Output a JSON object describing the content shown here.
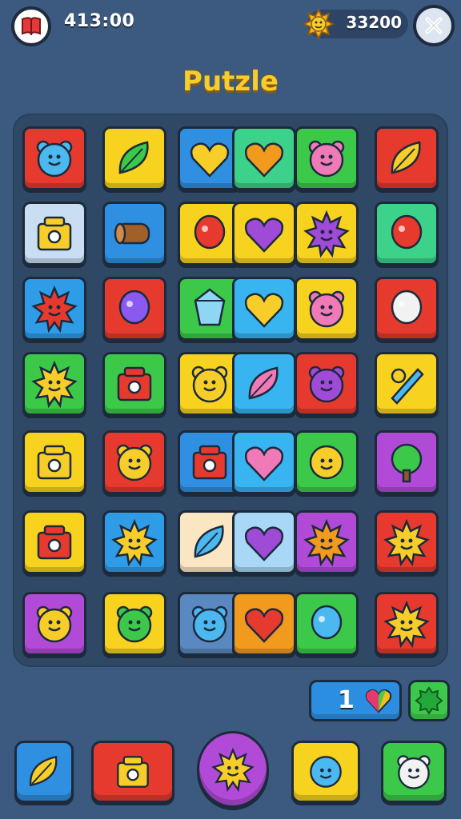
{
  "header": {
    "score_left": "413:00",
    "score_right": "33200",
    "book_icon": "red-book-icon",
    "coin_icon": "gold-sun-coin-icon",
    "close_icon": "close-icon"
  },
  "title": "Putzle",
  "board": {
    "tiles": [
      {
        "color": "#e63a2e",
        "icon": "blue-fuzzy-creature-icon"
      },
      {
        "color": "#f7d21e",
        "icon": "green-leaf-icon"
      },
      {
        "color": "#2f8fe0",
        "icon": "heart-check-icon"
      },
      {
        "color": "#3cd28a",
        "icon": "orange-heart-icon"
      },
      {
        "color": "#3cc94a",
        "icon": "pink-elephant-icon"
      },
      {
        "color": "#e63a2e",
        "icon": "yellow-leaf-icon"
      },
      {
        "color": "#c9def2",
        "icon": "camera-box-icon"
      },
      {
        "color": "#2f8fe0",
        "icon": "wooden-log-icon"
      },
      {
        "color": "#f7d21e",
        "icon": "red-balloon-icon"
      },
      {
        "color": "#f7d21e",
        "icon": "purple-heart-icon"
      },
      {
        "color": "#f7d21e",
        "icon": "purple-sun-face-icon"
      },
      {
        "color": "#3cd28a",
        "icon": "red-blob-eye-icon"
      },
      {
        "color": "#2f9ce8",
        "icon": "red-sun-face-icon"
      },
      {
        "color": "#e63a2e",
        "icon": "rainbow-blob-icon"
      },
      {
        "color": "#3cc94a",
        "icon": "blue-crystal-icon"
      },
      {
        "color": "#38b4f0",
        "icon": "yellow-heart-icon"
      },
      {
        "color": "#f7d21e",
        "icon": "pink-bear-icon"
      },
      {
        "color": "#e63a2e",
        "icon": "white-shell-icon"
      },
      {
        "color": "#3cc94a",
        "icon": "sun-wand-icon"
      },
      {
        "color": "#3cc94a",
        "icon": "red-gift-icon"
      },
      {
        "color": "#f7d21e",
        "icon": "yellow-critter-icon"
      },
      {
        "color": "#38b4f0",
        "icon": "pink-leaf-icon"
      },
      {
        "color": "#e63a2e",
        "icon": "purple-bear-icon"
      },
      {
        "color": "#f7d21e",
        "icon": "blue-pencil-icon"
      },
      {
        "color": "#f7d21e",
        "icon": "toy-house-icon"
      },
      {
        "color": "#e63a2e",
        "icon": "bear-face-icon"
      },
      {
        "color": "#2f8fe0",
        "icon": "red-box-icon"
      },
      {
        "color": "#38b4f0",
        "icon": "pink-heart-icon"
      },
      {
        "color": "#3cc94a",
        "icon": "yellow-smiley-icon"
      },
      {
        "color": "#b24ad8",
        "icon": "green-tree-icon"
      },
      {
        "color": "#f7d21e",
        "icon": "red-box-icon"
      },
      {
        "color": "#2f9ce8",
        "icon": "yellow-sun-face-icon"
      },
      {
        "color": "#fbe6c4",
        "icon": "blue-feather-icon"
      },
      {
        "color": "#a8d8f6",
        "icon": "purple-heart-icon"
      },
      {
        "color": "#b24ad8",
        "icon": "orange-sun-face-icon"
      },
      {
        "color": "#e63a2e",
        "icon": "yellow-sun-face-icon"
      },
      {
        "color": "#b24ad8",
        "icon": "yellow-bear-icon"
      },
      {
        "color": "#f7d21e",
        "icon": "green-bear-icon"
      },
      {
        "color": "#5a88c0",
        "icon": "blue-cat-icon"
      },
      {
        "color": "#f29a1e",
        "icon": "red-heart-icon"
      },
      {
        "color": "#3cc94a",
        "icon": "blue-comet-icon"
      },
      {
        "color": "#e63a2e",
        "icon": "yellow-sun-face-icon"
      }
    ]
  },
  "footer": {
    "count": "1",
    "count_icon": "rainbow-heart-icon",
    "small_icon": "green-gear-icon",
    "buttons": [
      {
        "color": "#2f8fe0",
        "icon": "feather-star-icon"
      },
      {
        "color": "#e63a2e",
        "icon": "house-icon"
      },
      {
        "color": "#b24ad8",
        "icon": "sun-face-icon"
      },
      {
        "color": "#f7d21e",
        "icon": "blue-face-icon"
      },
      {
        "color": "#3cc94a",
        "icon": "white-creature-icon"
      }
    ]
  }
}
